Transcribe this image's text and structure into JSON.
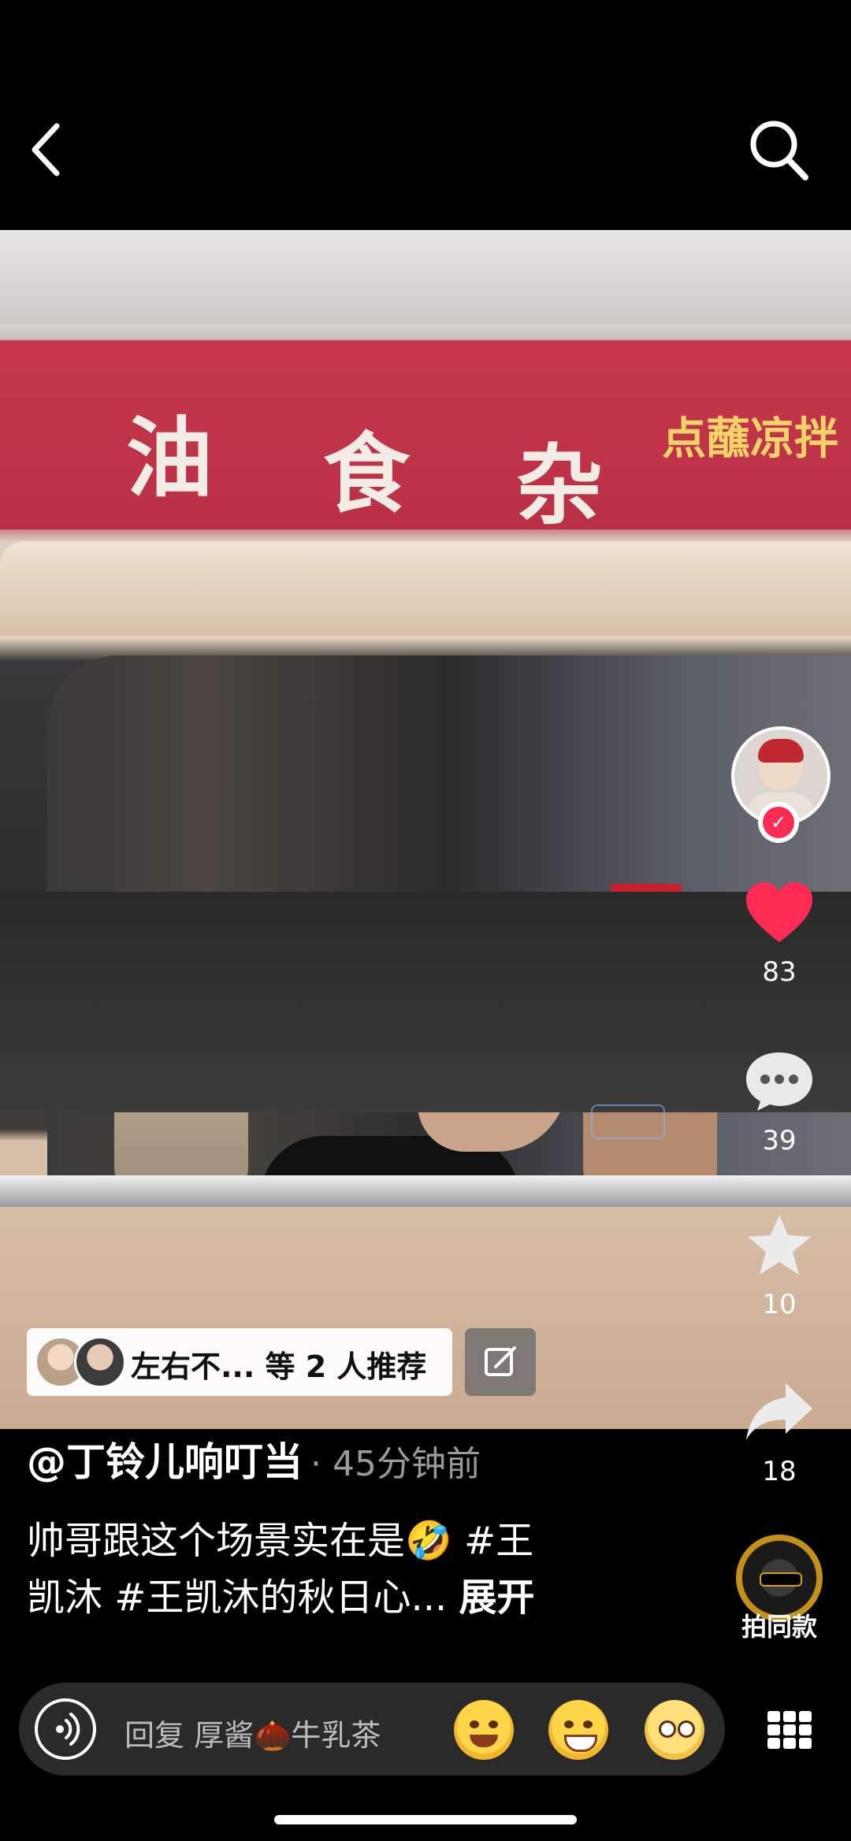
{
  "header": {
    "back_icon": "chevron-left-icon",
    "search_icon": "search-icon"
  },
  "video": {
    "banner_chars": [
      "油",
      "食",
      "杂"
    ],
    "banner_yellow": "点蘸凉拌"
  },
  "recommend": {
    "text": "左右不... 等 2 人推荐",
    "edit_icon": "edit-icon"
  },
  "actions": {
    "like_count": "83",
    "comment_count": "39",
    "favorite_count": "10",
    "share_count": "18",
    "sound_label": "拍同款"
  },
  "post": {
    "author": "@丁铃儿响叮当",
    "time": "· 45分钟前",
    "caption_line1": "帅哥跟这个场景实在是🤣 #王",
    "caption_line2": "凯沐 #王凯沐的秋日心...",
    "expand": "展开"
  },
  "reply_bar": {
    "text": "回复 厚酱🌰牛乳茶"
  },
  "colors": {
    "like_red": "#fe2c55",
    "background": "#000000"
  }
}
